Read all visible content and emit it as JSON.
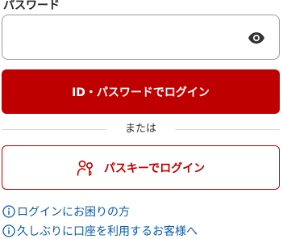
{
  "password": {
    "label": "パスワード",
    "value": "",
    "placeholder": "",
    "toggle_icon": "eye-icon"
  },
  "buttons": {
    "id_login": "ID・パスワードでログイン",
    "passkey_login": "パスキーでログイン",
    "passkey_icon": "passkey-key-person-icon"
  },
  "divider": {
    "text": "または"
  },
  "links": [
    {
      "label": "ログインにお困りの方",
      "icon": "info-icon"
    },
    {
      "label": "久しぶりに口座を利用するお客様へ",
      "icon": "info-icon"
    }
  ],
  "colors": {
    "primary_red": "#bf0000",
    "link_blue": "#0c5ca8",
    "field_border": "#9a9a9a"
  }
}
